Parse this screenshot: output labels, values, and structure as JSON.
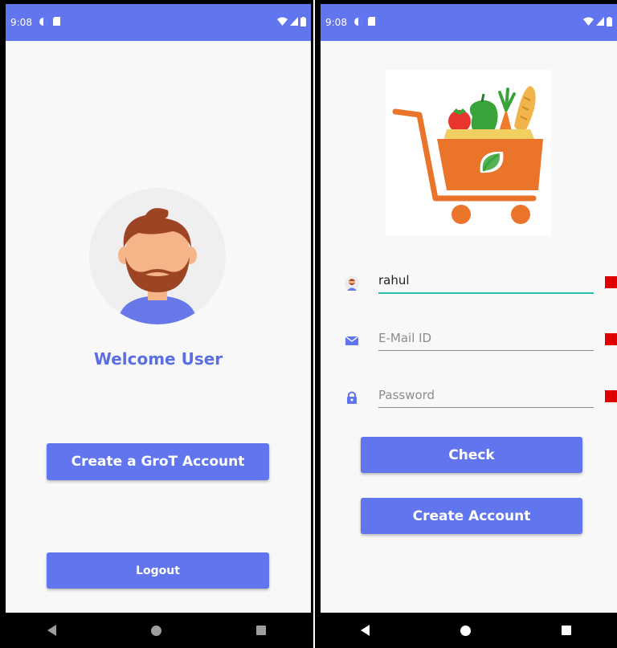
{
  "left_screen": {
    "status": {
      "time": "9:08"
    },
    "welcome_text": "Welcome User",
    "create_button_label": "Create a GroT Account",
    "logout_button_label": "Logout"
  },
  "right_screen": {
    "status": {
      "time": "9:08"
    },
    "username": {
      "value": "rahul",
      "icon": "user-avatar-icon"
    },
    "email": {
      "value": "",
      "placeholder": "E-Mail ID",
      "icon": "mail-icon"
    },
    "password": {
      "value": "",
      "placeholder": "Password",
      "icon": "lock-icon"
    },
    "check_button_label": "Check",
    "create_account_label": "Create Account",
    "error_color": "#e00000"
  },
  "colors": {
    "accent": "#6175ef",
    "welcome_text": "#5c6fe0",
    "focus_underline": "#2bbfae",
    "cart_orange": "#ea7429"
  }
}
